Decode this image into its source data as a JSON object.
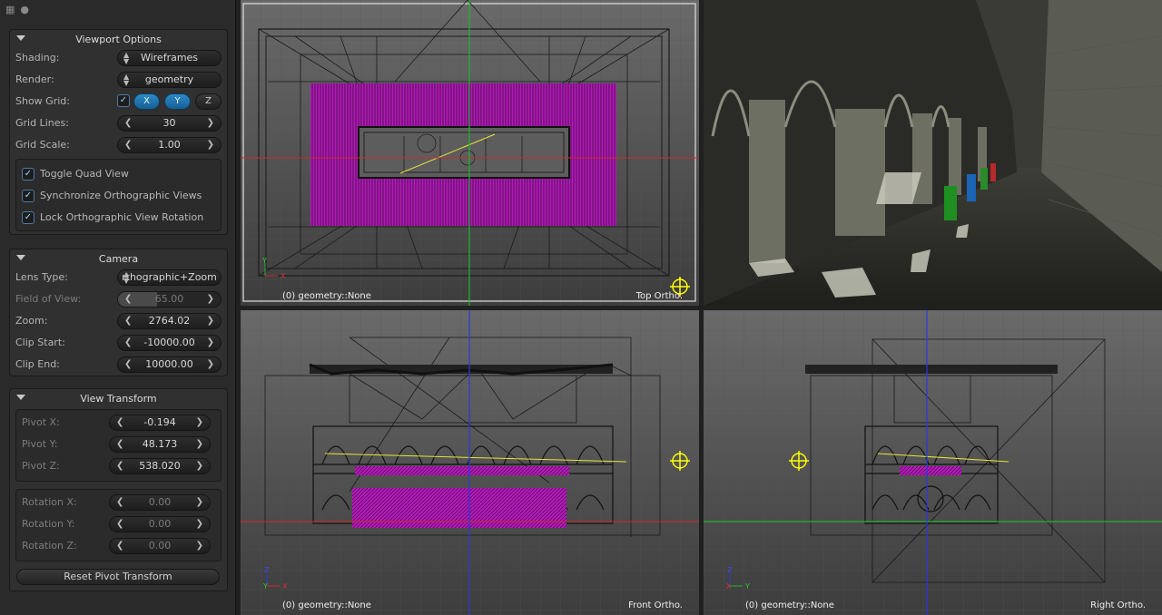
{
  "viewport_options": {
    "title": "Viewport Options",
    "shading_label": "Shading:",
    "shading_value": "Wireframes",
    "render_label": "Render:",
    "render_value": "geometry",
    "show_grid_label": "Show Grid:",
    "grid_axes": [
      "X",
      "Y",
      "Z"
    ],
    "grid_lines_label": "Grid Lines:",
    "grid_lines_value": "30",
    "grid_scale_label": "Grid Scale:",
    "grid_scale_value": "1.00",
    "toggle_quad": "Toggle Quad View",
    "sync_ortho": "Synchronize Orthographic Views",
    "lock_ortho": "Lock Orthographic View Rotation"
  },
  "camera": {
    "title": "Camera",
    "lens_label": "Lens Type:",
    "lens_value": "rthographic+Zoom",
    "fov_label": "Field of View:",
    "fov_value": "65.00",
    "zoom_label": "Zoom:",
    "zoom_value": "2764.02",
    "clip_start_label": "Clip Start:",
    "clip_start_value": "-10000.00",
    "clip_end_label": "Clip End:",
    "clip_end_value": "10000.00"
  },
  "view_transform": {
    "title": "View Transform",
    "pivot_x_label": "Pivot X:",
    "pivot_x_value": "-0.194",
    "pivot_y_label": "Pivot Y:",
    "pivot_y_value": "48.173",
    "pivot_z_label": "Pivot Z:",
    "pivot_z_value": "538.020",
    "rot_x_label": "Rotation X:",
    "rot_x_value": "0.00",
    "rot_y_label": "Rotation Y:",
    "rot_y_value": "0.00",
    "rot_z_label": "Rotation Z:",
    "rot_z_value": "0.00",
    "reset_label": "Reset Pivot Transform"
  },
  "viewports": {
    "top": {
      "info": "(0) geometry::None",
      "name": "Top Ortho."
    },
    "front": {
      "info": "(0) geometry::None",
      "name": "Front Ortho."
    },
    "right": {
      "info": "(0) geometry::None",
      "name": "Right Ortho."
    }
  },
  "colors": {
    "accent": "#2d8ac8",
    "wire_magenta": "#c218c8",
    "pivot_yellow": "#e8e800"
  }
}
